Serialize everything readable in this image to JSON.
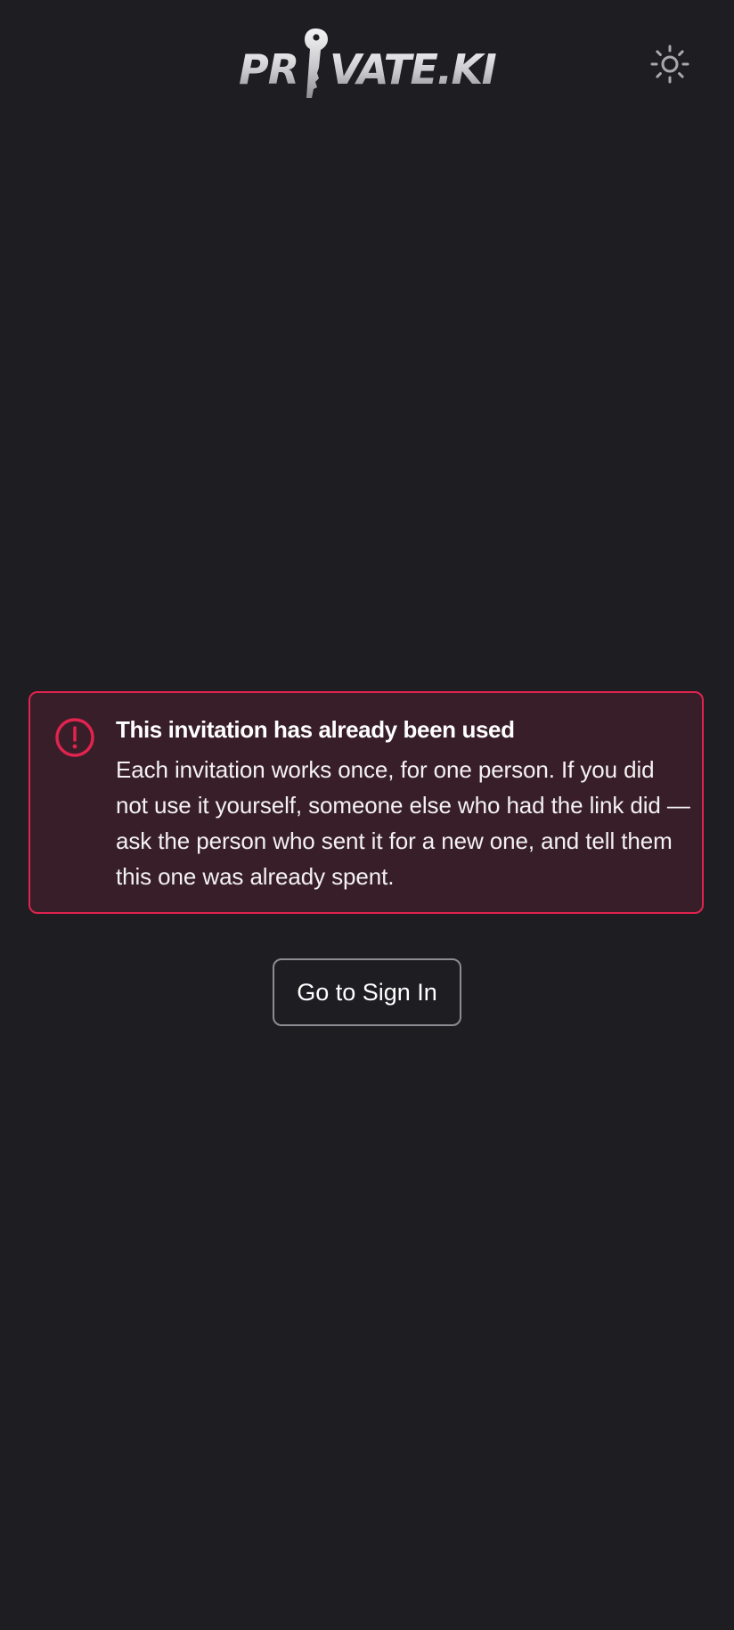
{
  "header": {
    "logo_text": "PRIVATE.KI",
    "theme_toggle_icon": "sun-icon"
  },
  "alert": {
    "icon": "alert-circle-icon",
    "title": "This invitation has already been used",
    "body": "Each invitation works once, for one person. If you did not use it yourself, someone else who had the link did — ask the person who sent it for a new one, and tell them this one was already spent.",
    "accent_color": "#e0234f"
  },
  "actions": {
    "signin_label": "Go to Sign In"
  },
  "theme": {
    "background": "#1e1d22",
    "alert_background": "#371e28"
  }
}
